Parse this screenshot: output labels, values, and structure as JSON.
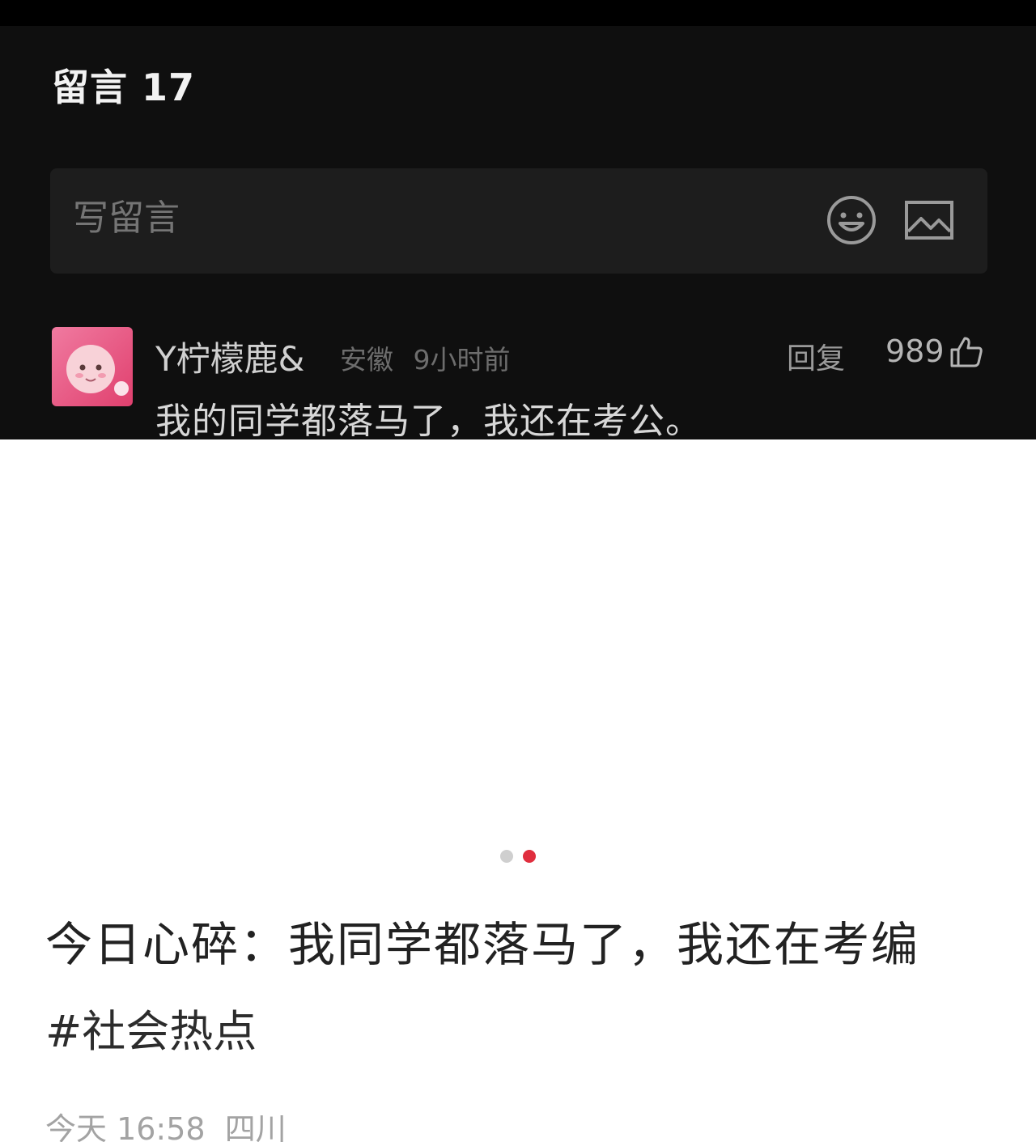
{
  "comments_header": {
    "label": "留言",
    "count": "17"
  },
  "composer": {
    "placeholder": "写留言",
    "icons": [
      "emoji-icon",
      "image-icon"
    ]
  },
  "comment": {
    "username": "Y柠檬鹿&",
    "location": "安徽",
    "time": "9小时前",
    "reply_label": "回复",
    "likes": "989",
    "text": "我的同学都落马了，我还在考公。"
  },
  "carousel": {
    "total": 2,
    "active_index": 1,
    "active_color": "#e02e3e",
    "inactive_color": "#cfcfcf"
  },
  "post": {
    "title": "今日心碎：我同学都落马了，我还在考编",
    "hashtag": "#社会热点",
    "date": "今天 16:58",
    "location": "四川"
  }
}
